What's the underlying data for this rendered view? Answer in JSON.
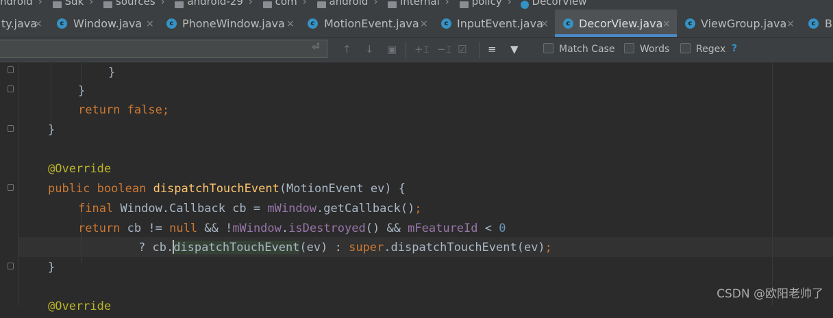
{
  "breadcrumb": {
    "items": [
      "ndroid",
      "Sdk",
      "sources",
      "android-29",
      "com",
      "android",
      "internal",
      "policy"
    ],
    "current": "DecorView"
  },
  "tabs": [
    {
      "label": "ty.java",
      "close": "×"
    },
    {
      "label": "Window.java",
      "close": "×"
    },
    {
      "label": "PhoneWindow.java",
      "close": "×"
    },
    {
      "label": "MotionEvent.java",
      "close": "×"
    },
    {
      "label": "InputEvent.java",
      "close": "×"
    },
    {
      "label": "DecorView.java",
      "close": "×",
      "active": true
    },
    {
      "label": "ViewGroup.java",
      "close": "×"
    },
    {
      "label": "Bi"
    }
  ],
  "search": {
    "value": "",
    "match_case": "Match Case",
    "words": "Words",
    "regex": "Regex",
    "help": "?"
  },
  "code": {
    "l1": "}",
    "l2": "}",
    "l3_kw": "return",
    "l3_v": "false",
    "l4": "}",
    "l5": "@Override",
    "l6_pub": "public",
    "l6_bool": "boolean",
    "l6_fn": "dispatchTouchEvent",
    "l6_rest": "(MotionEvent ev) {",
    "l7_final": "final",
    "l7_a": "Window.Callback cb = ",
    "l7_f": "mWindow",
    "l7_b": ".getCallback()",
    "l8_ret": "return",
    "l8_a": "cb != ",
    "l8_null": "null",
    "l8_b": " && !",
    "l8_f": "mWindow",
    "l8_dot": ".",
    "l8_m": "isDestroyed",
    "l8_c": "() && ",
    "l8_f2": "mFeatureId",
    "l8_lt": " < ",
    "l8_zero": "0",
    "l9_a": "? cb.",
    "l9_fn": "dispatchTouchEvent",
    "l9_b": "(ev) : ",
    "l9_super": "super",
    "l9_c": ".dispatchTouchEvent(ev)",
    "l10": "}",
    "l11": "@Override"
  },
  "watermark": "CSDN @欧阳老帅了"
}
